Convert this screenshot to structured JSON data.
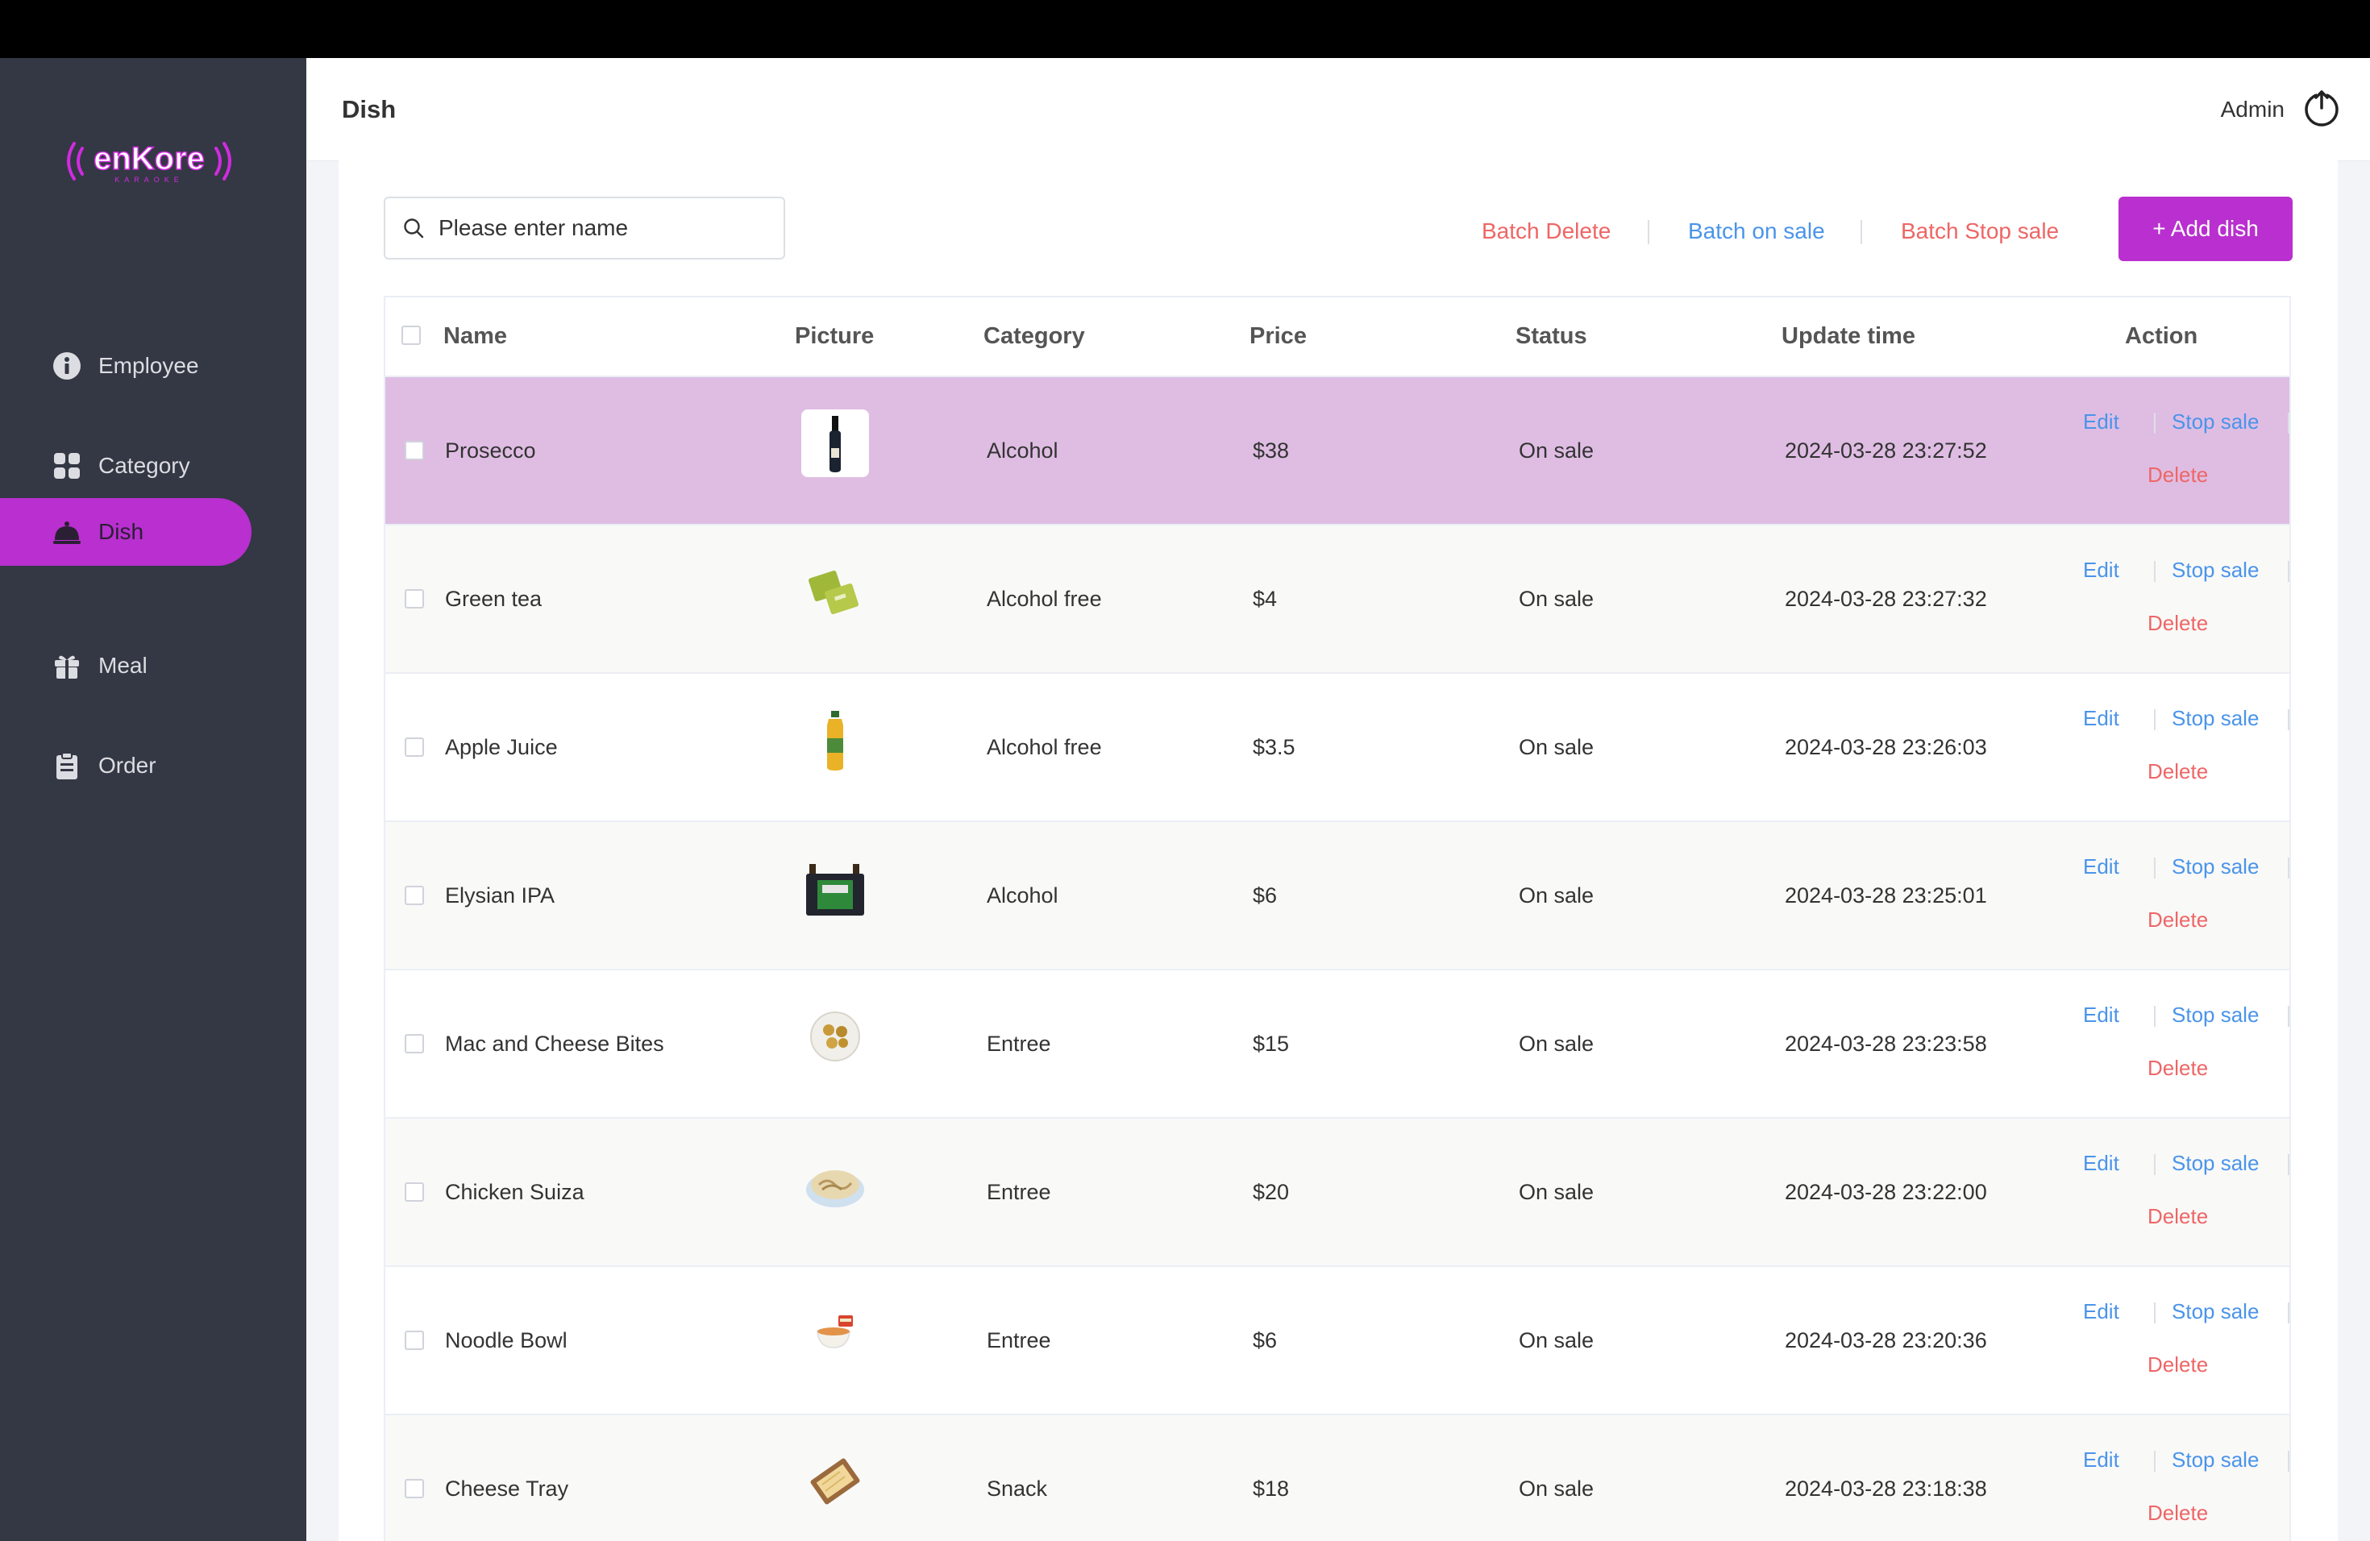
{
  "brand": {
    "logo_text": "enKore"
  },
  "sidebar": {
    "items": [
      {
        "label": "Employee",
        "icon": "info-circle-icon"
      },
      {
        "label": "Category",
        "icon": "grid-icon"
      },
      {
        "label": "Dish",
        "icon": "cloche-icon",
        "active": true
      },
      {
        "label": "Meal",
        "icon": "gift-icon"
      },
      {
        "label": "Order",
        "icon": "clipboard-icon"
      }
    ]
  },
  "header": {
    "title": "Dish",
    "user": "Admin",
    "logout_icon": "power-icon"
  },
  "toolbar": {
    "search_placeholder": "Please enter name",
    "batch_delete": "Batch Delete",
    "batch_on_sale": "Batch on sale",
    "batch_stop_sale": "Batch Stop sale",
    "add_dish": "+ Add dish"
  },
  "table": {
    "columns": [
      "Name",
      "Picture",
      "Category",
      "Price",
      "Status",
      "Update time",
      "Action"
    ],
    "actions": {
      "edit": "Edit",
      "stop": "Stop sale",
      "delete": "Delete"
    },
    "rows": [
      {
        "name": "Prosecco",
        "picture": "wine-bottle",
        "category": "Alcohol",
        "price": "$38",
        "status": "On sale",
        "updated": "2024-03-28 23:27:52"
      },
      {
        "name": "Green tea",
        "picture": "tea-bags",
        "category": "Alcohol free",
        "price": "$4",
        "status": "On sale",
        "updated": "2024-03-28 23:27:32"
      },
      {
        "name": "Apple Juice",
        "picture": "juice-bottle",
        "category": "Alcohol free",
        "price": "$3.5",
        "status": "On sale",
        "updated": "2024-03-28 23:26:03"
      },
      {
        "name": "Elysian IPA",
        "picture": "beer-six-pack",
        "category": "Alcohol",
        "price": "$6",
        "status": "On sale",
        "updated": "2024-03-28 23:25:01"
      },
      {
        "name": "Mac and Cheese Bites",
        "picture": "bites-plate",
        "category": "Entree",
        "price": "$15",
        "status": "On sale",
        "updated": "2024-03-28 23:23:58"
      },
      {
        "name": "Chicken Suiza",
        "picture": "pasta-plate",
        "category": "Entree",
        "price": "$20",
        "status": "On sale",
        "updated": "2024-03-28 23:22:00"
      },
      {
        "name": "Noodle Bowl",
        "picture": "noodle-bowl",
        "category": "Entree",
        "price": "$6",
        "status": "On sale",
        "updated": "2024-03-28 23:20:36"
      },
      {
        "name": "Cheese Tray",
        "picture": "cheese-tray",
        "category": "Snack",
        "price": "$18",
        "status": "On sale",
        "updated": "2024-03-28 23:18:38"
      }
    ]
  },
  "colors": {
    "accent": "#b92fcf",
    "link": "#4a94ea",
    "danger": "#ee6666",
    "sidebar": "#343744",
    "selected_row": "#dfbde3"
  }
}
